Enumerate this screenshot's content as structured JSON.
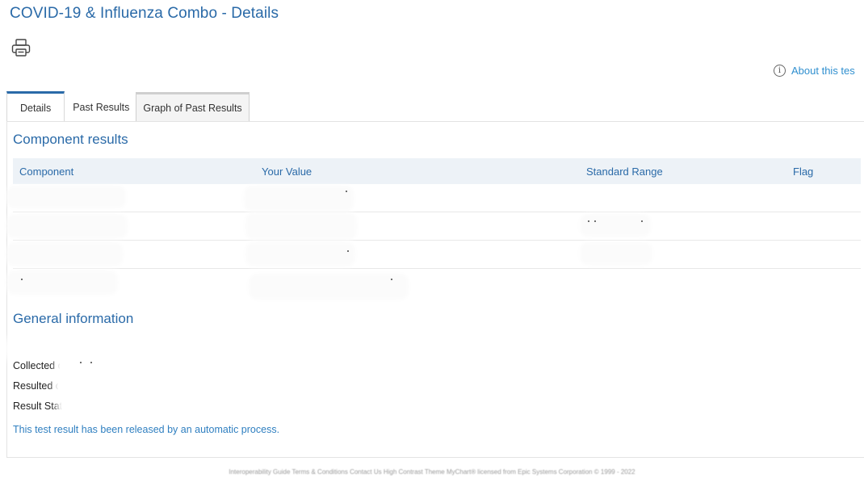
{
  "header": {
    "title": "COVID-19 & Influenza Combo - Details",
    "print_icon": "printer-icon",
    "about_link": "About this tes",
    "about_icon": "info-circle-icon"
  },
  "tabs": [
    {
      "label": "Details",
      "active": true
    },
    {
      "label": "Past Results",
      "active": false
    },
    {
      "label": "Graph of Past Results",
      "active": false
    }
  ],
  "component_results": {
    "title": "Component results",
    "columns": [
      "Component",
      "Your Value",
      "Standard Range",
      "Flag"
    ]
  },
  "general_information": {
    "title": "General information",
    "collected_label": "Collected on",
    "resulted_label": "Resulted on",
    "status_label": "Result Status",
    "release_note": "This test result has been released by an automatic process."
  },
  "footer": {
    "text": "Interoperability Guide   Terms & Conditions   Contact Us   High Contrast Theme        MyChart® licensed from Epic Systems Corporation © 1999 - 2022"
  },
  "colors": {
    "accent": "#2a6aa8",
    "link": "#2f8fcf",
    "table_header_bg": "#edf2f7"
  }
}
